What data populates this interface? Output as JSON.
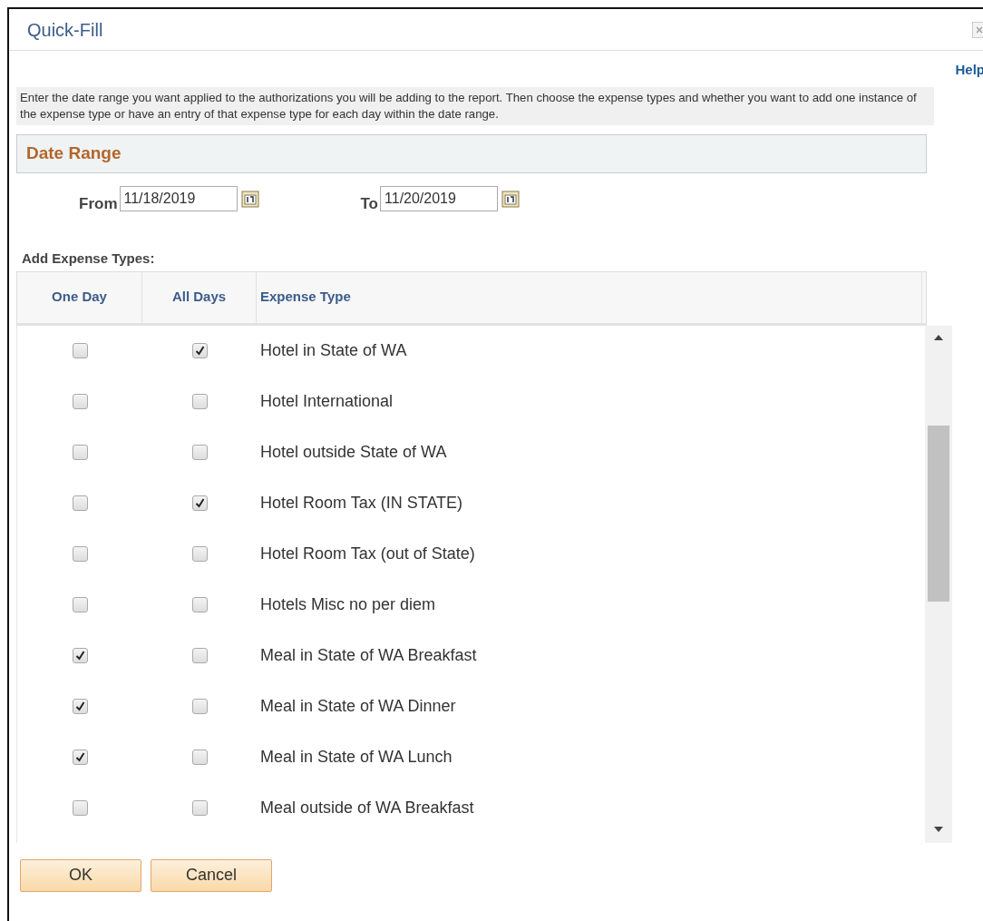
{
  "window": {
    "title": "Quick-Fill"
  },
  "help_link": "Help",
  "instructions": "Enter the date range you want applied to the authorizations you will be adding to the report. Then choose the expense types and whether you want to add one instance of the expense type or have an entry of that expense type for each day within the date range.",
  "date_range": {
    "heading": "Date Range",
    "from_label": "From",
    "from_value": "11/18/2019",
    "to_label": "To",
    "to_value": "11/20/2019"
  },
  "expense_section": {
    "heading": "Add Expense Types:"
  },
  "table": {
    "columns": [
      "One Day",
      "All Days",
      "Expense Type"
    ],
    "rows": [
      {
        "one_day": false,
        "all_days": true,
        "expense_type": "Hotel in State of WA"
      },
      {
        "one_day": false,
        "all_days": false,
        "expense_type": "Hotel International"
      },
      {
        "one_day": false,
        "all_days": false,
        "expense_type": "Hotel outside State of WA"
      },
      {
        "one_day": false,
        "all_days": true,
        "expense_type": "Hotel Room Tax (IN STATE)"
      },
      {
        "one_day": false,
        "all_days": false,
        "expense_type": "Hotel Room Tax (out of State)"
      },
      {
        "one_day": false,
        "all_days": false,
        "expense_type": "Hotels Misc no per diem"
      },
      {
        "one_day": true,
        "all_days": false,
        "expense_type": "Meal in State of WA Breakfast"
      },
      {
        "one_day": true,
        "all_days": false,
        "expense_type": "Meal in State of WA Dinner"
      },
      {
        "one_day": true,
        "all_days": false,
        "expense_type": "Meal in State of WA Lunch"
      },
      {
        "one_day": false,
        "all_days": false,
        "expense_type": "Meal outside of WA Breakfast"
      }
    ]
  },
  "buttons": [
    "OK",
    "Cancel"
  ]
}
